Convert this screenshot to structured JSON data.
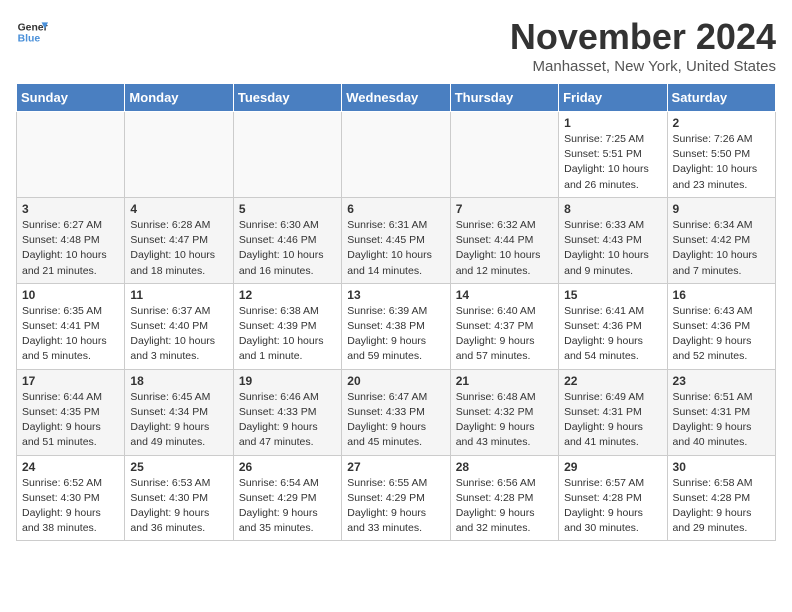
{
  "header": {
    "logo_general": "General",
    "logo_blue": "Blue",
    "month": "November 2024",
    "location": "Manhasset, New York, United States"
  },
  "days_of_week": [
    "Sunday",
    "Monday",
    "Tuesday",
    "Wednesday",
    "Thursday",
    "Friday",
    "Saturday"
  ],
  "weeks": [
    [
      {
        "day": "",
        "info": ""
      },
      {
        "day": "",
        "info": ""
      },
      {
        "day": "",
        "info": ""
      },
      {
        "day": "",
        "info": ""
      },
      {
        "day": "",
        "info": ""
      },
      {
        "day": "1",
        "info": "Sunrise: 7:25 AM\nSunset: 5:51 PM\nDaylight: 10 hours\nand 26 minutes."
      },
      {
        "day": "2",
        "info": "Sunrise: 7:26 AM\nSunset: 5:50 PM\nDaylight: 10 hours\nand 23 minutes."
      }
    ],
    [
      {
        "day": "3",
        "info": "Sunrise: 6:27 AM\nSunset: 4:48 PM\nDaylight: 10 hours\nand 21 minutes."
      },
      {
        "day": "4",
        "info": "Sunrise: 6:28 AM\nSunset: 4:47 PM\nDaylight: 10 hours\nand 18 minutes."
      },
      {
        "day": "5",
        "info": "Sunrise: 6:30 AM\nSunset: 4:46 PM\nDaylight: 10 hours\nand 16 minutes."
      },
      {
        "day": "6",
        "info": "Sunrise: 6:31 AM\nSunset: 4:45 PM\nDaylight: 10 hours\nand 14 minutes."
      },
      {
        "day": "7",
        "info": "Sunrise: 6:32 AM\nSunset: 4:44 PM\nDaylight: 10 hours\nand 12 minutes."
      },
      {
        "day": "8",
        "info": "Sunrise: 6:33 AM\nSunset: 4:43 PM\nDaylight: 10 hours\nand 9 minutes."
      },
      {
        "day": "9",
        "info": "Sunrise: 6:34 AM\nSunset: 4:42 PM\nDaylight: 10 hours\nand 7 minutes."
      }
    ],
    [
      {
        "day": "10",
        "info": "Sunrise: 6:35 AM\nSunset: 4:41 PM\nDaylight: 10 hours\nand 5 minutes."
      },
      {
        "day": "11",
        "info": "Sunrise: 6:37 AM\nSunset: 4:40 PM\nDaylight: 10 hours\nand 3 minutes."
      },
      {
        "day": "12",
        "info": "Sunrise: 6:38 AM\nSunset: 4:39 PM\nDaylight: 10 hours\nand 1 minute."
      },
      {
        "day": "13",
        "info": "Sunrise: 6:39 AM\nSunset: 4:38 PM\nDaylight: 9 hours\nand 59 minutes."
      },
      {
        "day": "14",
        "info": "Sunrise: 6:40 AM\nSunset: 4:37 PM\nDaylight: 9 hours\nand 57 minutes."
      },
      {
        "day": "15",
        "info": "Sunrise: 6:41 AM\nSunset: 4:36 PM\nDaylight: 9 hours\nand 54 minutes."
      },
      {
        "day": "16",
        "info": "Sunrise: 6:43 AM\nSunset: 4:36 PM\nDaylight: 9 hours\nand 52 minutes."
      }
    ],
    [
      {
        "day": "17",
        "info": "Sunrise: 6:44 AM\nSunset: 4:35 PM\nDaylight: 9 hours\nand 51 minutes."
      },
      {
        "day": "18",
        "info": "Sunrise: 6:45 AM\nSunset: 4:34 PM\nDaylight: 9 hours\nand 49 minutes."
      },
      {
        "day": "19",
        "info": "Sunrise: 6:46 AM\nSunset: 4:33 PM\nDaylight: 9 hours\nand 47 minutes."
      },
      {
        "day": "20",
        "info": "Sunrise: 6:47 AM\nSunset: 4:33 PM\nDaylight: 9 hours\nand 45 minutes."
      },
      {
        "day": "21",
        "info": "Sunrise: 6:48 AM\nSunset: 4:32 PM\nDaylight: 9 hours\nand 43 minutes."
      },
      {
        "day": "22",
        "info": "Sunrise: 6:49 AM\nSunset: 4:31 PM\nDaylight: 9 hours\nand 41 minutes."
      },
      {
        "day": "23",
        "info": "Sunrise: 6:51 AM\nSunset: 4:31 PM\nDaylight: 9 hours\nand 40 minutes."
      }
    ],
    [
      {
        "day": "24",
        "info": "Sunrise: 6:52 AM\nSunset: 4:30 PM\nDaylight: 9 hours\nand 38 minutes."
      },
      {
        "day": "25",
        "info": "Sunrise: 6:53 AM\nSunset: 4:30 PM\nDaylight: 9 hours\nand 36 minutes."
      },
      {
        "day": "26",
        "info": "Sunrise: 6:54 AM\nSunset: 4:29 PM\nDaylight: 9 hours\nand 35 minutes."
      },
      {
        "day": "27",
        "info": "Sunrise: 6:55 AM\nSunset: 4:29 PM\nDaylight: 9 hours\nand 33 minutes."
      },
      {
        "day": "28",
        "info": "Sunrise: 6:56 AM\nSunset: 4:28 PM\nDaylight: 9 hours\nand 32 minutes."
      },
      {
        "day": "29",
        "info": "Sunrise: 6:57 AM\nSunset: 4:28 PM\nDaylight: 9 hours\nand 30 minutes."
      },
      {
        "day": "30",
        "info": "Sunrise: 6:58 AM\nSunset: 4:28 PM\nDaylight: 9 hours\nand 29 minutes."
      }
    ]
  ]
}
